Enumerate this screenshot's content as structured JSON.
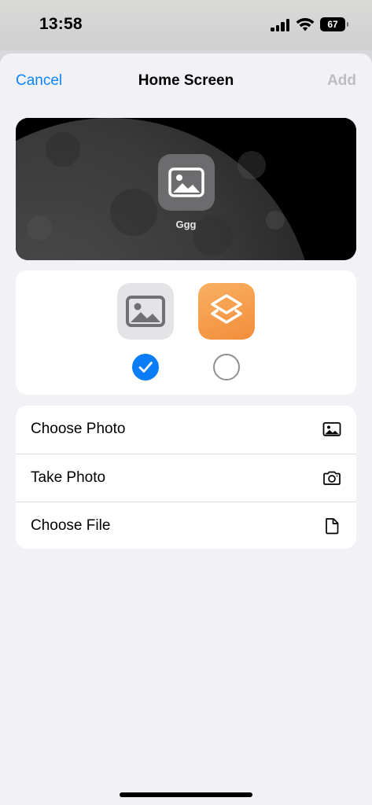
{
  "status_bar": {
    "time": "13:58",
    "battery": "67",
    "icons": [
      "cellular-signal-icon",
      "wifi-icon",
      "battery-icon"
    ]
  },
  "nav": {
    "cancel_label": "Cancel",
    "title": "Home Screen",
    "add_label": "Add"
  },
  "preview": {
    "icon": "photo-placeholder-icon",
    "label": "Ggg"
  },
  "icon_choices": {
    "options": [
      {
        "icon": "photo-placeholder-icon",
        "selected": true
      },
      {
        "icon": "shortcuts-app-icon",
        "selected": false
      }
    ]
  },
  "options": [
    {
      "label": "Choose Photo",
      "icon": "photo-icon"
    },
    {
      "label": "Take Photo",
      "icon": "camera-icon"
    },
    {
      "label": "Choose File",
      "icon": "document-icon"
    }
  ],
  "colors": {
    "accent": "#0a84ff",
    "disabled": "#bdbdc2",
    "shortcuts_orange": "#f59a48",
    "background": "#f2f2f6"
  }
}
